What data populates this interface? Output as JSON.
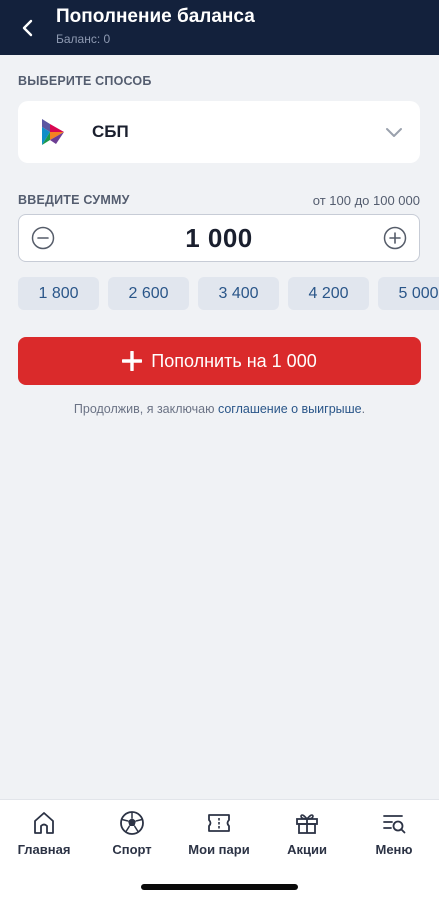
{
  "header": {
    "title": "Пополнение баланса",
    "subtitle": "Баланс: 0",
    "back_icon": "chevron-left-icon"
  },
  "method": {
    "section_label": "ВЫБЕРИТЕ СПОСОБ",
    "selected": "СБП",
    "logo": "sbp-logo-icon",
    "chevron": "chevron-down-icon"
  },
  "amount": {
    "section_label": "ВВЕДИТЕ СУММУ",
    "range": "от 100 до 100 000",
    "value": "1 000",
    "minus_icon": "minus-circle-icon",
    "plus_icon": "plus-circle-icon"
  },
  "quick_amounts": [
    "1 800",
    "2 600",
    "3 400",
    "4 200",
    "5 000"
  ],
  "submit": {
    "label": "Пополнить на 1 000",
    "icon": "plus-icon",
    "color": "#da2a2b"
  },
  "agreement": {
    "prefix": "Продолжив, я заключаю ",
    "link": "соглашение о выигрыше",
    "suffix": "."
  },
  "nav": {
    "items": [
      {
        "label": "Главная",
        "icon": "home-icon"
      },
      {
        "label": "Спорт",
        "icon": "soccer-ball-icon"
      },
      {
        "label": "Мои пари",
        "icon": "ticket-icon"
      },
      {
        "label": "Акции",
        "icon": "gift-icon"
      },
      {
        "label": "Меню",
        "icon": "menu-search-icon"
      }
    ]
  },
  "colors": {
    "header_bg": "#13213c",
    "accent": "#da2a2b",
    "link": "#2a5689",
    "page_bg": "#f0f2f5"
  }
}
